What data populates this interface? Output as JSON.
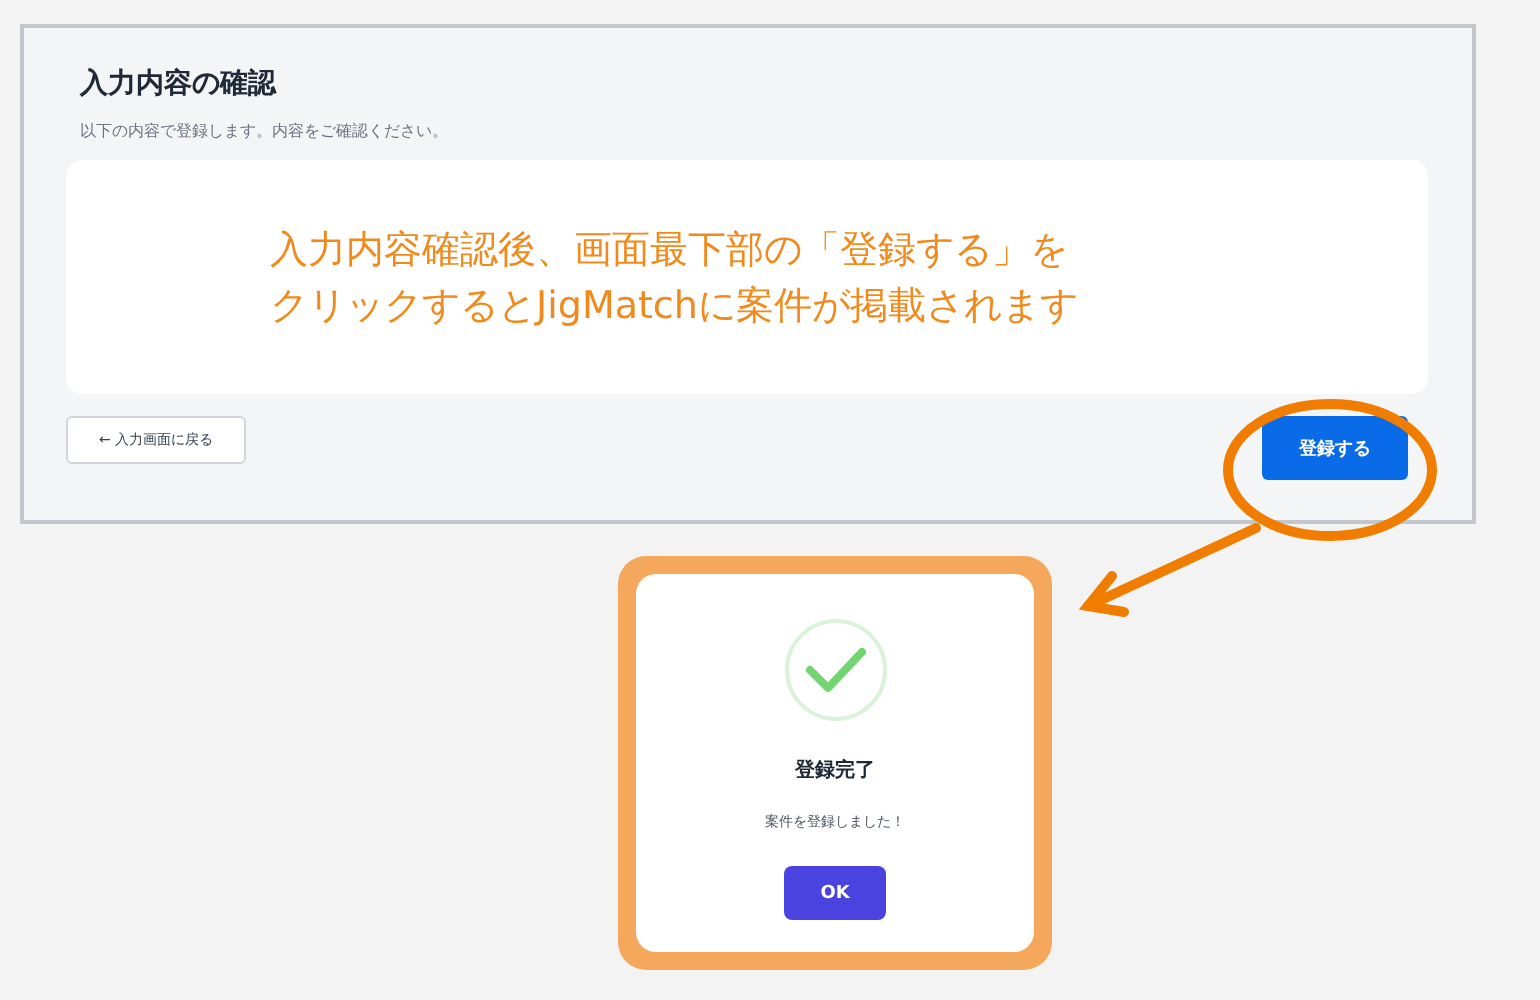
{
  "screen": {
    "title": "入力内容の確認",
    "subtitle": "以下の内容で登録します。内容をご確認ください。",
    "back_button": "← 入力画面に戻る",
    "submit_button": "登録する"
  },
  "callout": {
    "lines": [
      "入力内容確認後、画面最下部の「登録する」を",
      "クリックするとJigMatchに案件が掲載されます"
    ]
  },
  "dialog": {
    "title": "登録完了",
    "message": "案件を登録しました！",
    "ok_button": "OK"
  }
}
